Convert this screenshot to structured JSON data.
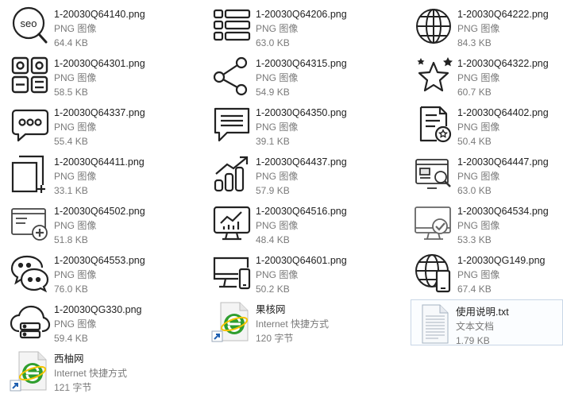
{
  "files": [
    {
      "name": "1-20030Q64140.png",
      "type": "PNG 图像",
      "size": "64.4 KB",
      "icon": "seo-icon"
    },
    {
      "name": "1-20030Q64206.png",
      "type": "PNG 图像",
      "size": "63.0 KB",
      "icon": "list-icon"
    },
    {
      "name": "1-20030Q64222.png",
      "type": "PNG 图像",
      "size": "84.3 KB",
      "icon": "globe-icon"
    },
    {
      "name": "1-20030Q64301.png",
      "type": "PNG 图像",
      "size": "58.5 KB",
      "icon": "apps-grid-icon"
    },
    {
      "name": "1-20030Q64315.png",
      "type": "PNG 图像",
      "size": "54.9 KB",
      "icon": "share-icon"
    },
    {
      "name": "1-20030Q64322.png",
      "type": "PNG 图像",
      "size": "60.7 KB",
      "icon": "star-icon"
    },
    {
      "name": "1-20030Q64337.png",
      "type": "PNG 图像",
      "size": "55.4 KB",
      "icon": "chat-bubble-icon"
    },
    {
      "name": "1-20030Q64350.png",
      "type": "PNG 图像",
      "size": "39.1 KB",
      "icon": "message-icon"
    },
    {
      "name": "1-20030Q64402.png",
      "type": "PNG 图像",
      "size": "50.4 KB",
      "icon": "certificate-icon"
    },
    {
      "name": "1-20030Q64411.png",
      "type": "PNG 图像",
      "size": "33.1 KB",
      "icon": "add-page-icon"
    },
    {
      "name": "1-20030Q64437.png",
      "type": "PNG 图像",
      "size": "57.9 KB",
      "icon": "growth-chart-icon"
    },
    {
      "name": "1-20030Q64447.png",
      "type": "PNG 图像",
      "size": "63.0 KB",
      "icon": "web-search-icon"
    },
    {
      "name": "1-20030Q64502.png",
      "type": "PNG 图像",
      "size": "51.8 KB",
      "icon": "browser-add-icon"
    },
    {
      "name": "1-20030Q64516.png",
      "type": "PNG 图像",
      "size": "48.4 KB",
      "icon": "monitor-chart-icon"
    },
    {
      "name": "1-20030Q64534.png",
      "type": "PNG 图像",
      "size": "53.3 KB",
      "icon": "monitor-check-icon"
    },
    {
      "name": "1-20030Q64553.png",
      "type": "PNG 图像",
      "size": "76.0 KB",
      "icon": "chat-bubbles-icon"
    },
    {
      "name": "1-20030Q64601.png",
      "type": "PNG 图像",
      "size": "50.2 KB",
      "icon": "responsive-devices-icon"
    },
    {
      "name": "1-20030QG149.png",
      "type": "PNG 图像",
      "size": "67.4 KB",
      "icon": "globe-phone-icon"
    },
    {
      "name": "1-20030QG330.png",
      "type": "PNG 图像",
      "size": "59.4 KB",
      "icon": "cloud-server-icon"
    },
    {
      "name": "果核网",
      "type": "Internet 快捷方式",
      "size": "120 字节",
      "icon": "internet-shortcut-icon"
    },
    {
      "name": "使用说明.txt",
      "type": "文本文档",
      "size": "1.79 KB",
      "icon": "text-document-icon"
    },
    {
      "name": "西柚网",
      "type": "Internet 快捷方式",
      "size": "121 字节",
      "icon": "internet-shortcut-icon"
    }
  ]
}
